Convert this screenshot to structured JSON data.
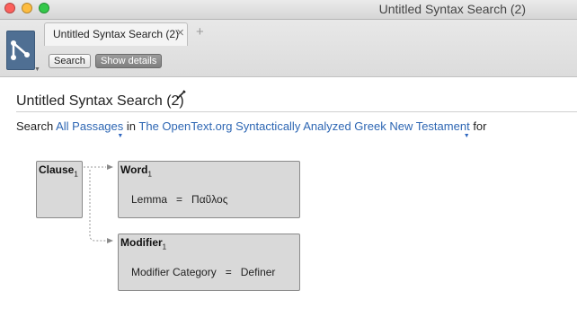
{
  "window": {
    "title": "Untitled Syntax Search (2)"
  },
  "tabs": [
    {
      "label": "Untitled Syntax Search (2)"
    }
  ],
  "toolbar": {
    "search_label": "Search",
    "details_label": "Show details"
  },
  "search": {
    "title": "Untitled Syntax Search (2)",
    "prefix": "Search",
    "scope": "All Passages",
    "in_word": "in",
    "resource": "The OpenText.org Syntactically Analyzed Greek New Testament",
    "suffix": "for"
  },
  "nodes": {
    "clause": {
      "label": "Clause",
      "index": "1"
    },
    "word": {
      "label": "Word",
      "index": "1",
      "criterion": {
        "field": "Lemma",
        "op": "=",
        "value": "Παῦλος"
      }
    },
    "modifier": {
      "label": "Modifier",
      "index": "1",
      "criterion": {
        "field": "Modifier Category",
        "op": "=",
        "value": "Definer"
      }
    }
  },
  "colors": {
    "link": "#2d66b3",
    "node_fill": "#d9d9d9",
    "logo": "#4f6f93"
  }
}
